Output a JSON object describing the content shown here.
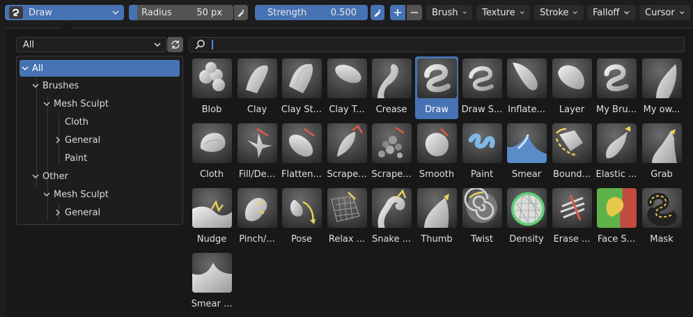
{
  "header": {
    "brush": "Draw",
    "radius": {
      "label": "Radius",
      "value": "50 px"
    },
    "strength": {
      "label": "Strength",
      "value": "0.500"
    },
    "menus": [
      "Brush",
      "Texture",
      "Stroke",
      "Falloff",
      "Cursor"
    ]
  },
  "filter": {
    "selected": "All"
  },
  "tree": [
    "All",
    "Brushes",
    "Mesh Sculpt",
    "Cloth",
    "General",
    "Paint",
    "Other",
    "Mesh Sculpt",
    "General"
  ],
  "search": {
    "value": ""
  },
  "colors": {
    "accent": "#4772b3",
    "panel": "#181818",
    "field": "#545454"
  },
  "brushes": [
    {
      "label": "Blob",
      "icon": "blob-brush-icon"
    },
    {
      "label": "Clay",
      "icon": "clay-brush-icon"
    },
    {
      "label": "Clay St...",
      "icon": "clay-strips-brush-icon"
    },
    {
      "label": "Clay T...",
      "icon": "clay-thumb-brush-icon"
    },
    {
      "label": "Crease",
      "icon": "crease-brush-icon"
    },
    {
      "label": "Draw",
      "icon": "draw-brush-icon",
      "selected": true
    },
    {
      "label": "Draw S...",
      "icon": "draw-sharp-brush-icon"
    },
    {
      "label": "Inflate...",
      "icon": "inflate-brush-icon"
    },
    {
      "label": "Layer",
      "icon": "layer-brush-icon"
    },
    {
      "label": "My Bru...",
      "icon": "my-brush-icon"
    },
    {
      "label": "My ow...",
      "icon": "my-own-brush-icon"
    },
    {
      "label": "Cloth",
      "icon": "cloth-brush-icon"
    },
    {
      "label": "Fill/De...",
      "icon": "fill-brush-icon"
    },
    {
      "label": "Flatten...",
      "icon": "flatten-brush-icon"
    },
    {
      "label": "Scrape...",
      "icon": "scrape-brush-icon"
    },
    {
      "label": "Scrape...",
      "icon": "scrape-multiplane-brush-icon"
    },
    {
      "label": "Smooth",
      "icon": "smooth-brush-icon"
    },
    {
      "label": "Paint",
      "icon": "paint-brush-icon"
    },
    {
      "label": "Smear",
      "icon": "smear-brush-icon"
    },
    {
      "label": "Bound...",
      "icon": "boundary-brush-icon"
    },
    {
      "label": "Elastic ...",
      "icon": "elastic-brush-icon"
    },
    {
      "label": "Grab",
      "icon": "grab-brush-icon"
    },
    {
      "label": "Nudge",
      "icon": "nudge-brush-icon"
    },
    {
      "label": "Pinch/...",
      "icon": "pinch-brush-icon"
    },
    {
      "label": "Pose",
      "icon": "pose-brush-icon"
    },
    {
      "label": "Relax ...",
      "icon": "relax-brush-icon"
    },
    {
      "label": "Snake ...",
      "icon": "snake-hook-brush-icon"
    },
    {
      "label": "Thumb",
      "icon": "thumb-brush-icon"
    },
    {
      "label": "Twist",
      "icon": "twist-brush-icon"
    },
    {
      "label": "Density",
      "icon": "density-brush-icon"
    },
    {
      "label": "Erase ...",
      "icon": "erase-brush-icon"
    },
    {
      "label": "Face S...",
      "icon": "face-set-brush-icon"
    },
    {
      "label": "Mask",
      "icon": "mask-brush-icon"
    },
    {
      "label": "Smear ...",
      "icon": "smear-multires-brush-icon"
    }
  ]
}
